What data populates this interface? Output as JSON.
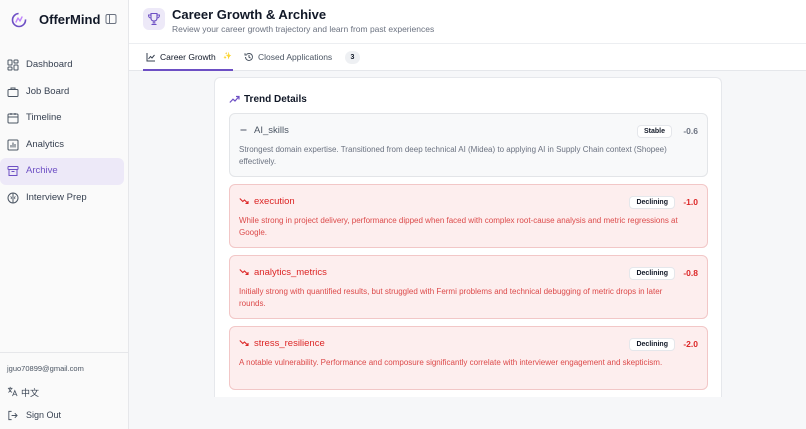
{
  "app": {
    "name": "OfferMind"
  },
  "sidebar": {
    "items": [
      {
        "label": "Dashboard",
        "icon": "dashboard-icon"
      },
      {
        "label": "Job Board",
        "icon": "briefcase-icon"
      },
      {
        "label": "Timeline",
        "icon": "calendar-icon"
      },
      {
        "label": "Analytics",
        "icon": "bar-chart-icon"
      },
      {
        "label": "Archive",
        "icon": "archive-icon",
        "active": true
      },
      {
        "label": "Interview Prep",
        "icon": "brain-icon"
      }
    ],
    "footer": {
      "email": "jguo70899@gmail.com",
      "language": "中文",
      "sign_out": "Sign Out"
    }
  },
  "header": {
    "title": "Career Growth & Archive",
    "subtitle": "Review your career growth trajectory and learn from past experiences"
  },
  "tabs": [
    {
      "label": "Career Growth",
      "sparkle": "✨",
      "active": true
    },
    {
      "label": "Closed Applications",
      "count": "3"
    }
  ],
  "panel": {
    "title": "Trend Details",
    "cards": [
      {
        "name": "AI_skills",
        "status": "Stable",
        "delta": "-0.6",
        "description": "Strongest domain expertise. Transitioned from deep technical AI (Midea) to applying AI in Supply Chain context (Shopee) effectively."
      },
      {
        "name": "execution",
        "status": "Declining",
        "delta": "-1.0",
        "description": "While strong in project delivery, performance dipped when faced with complex root-cause analysis and metric regressions at Google."
      },
      {
        "name": "analytics_metrics",
        "status": "Declining",
        "delta": "-0.8",
        "description": "Initially strong with quantified results, but struggled with Fermi problems and technical debugging of metric drops in later rounds."
      },
      {
        "name": "stress_resilience",
        "status": "Declining",
        "delta": "-2.0",
        "description": "A notable vulnerability. Performance and composure significantly correlate with interviewer engagement and skepticism."
      }
    ]
  },
  "colors": {
    "accent": "#6d4fc4",
    "declining": "#dc2626",
    "declining_bg": "#fdeeee",
    "stable_bg": "#f8f9fa"
  }
}
